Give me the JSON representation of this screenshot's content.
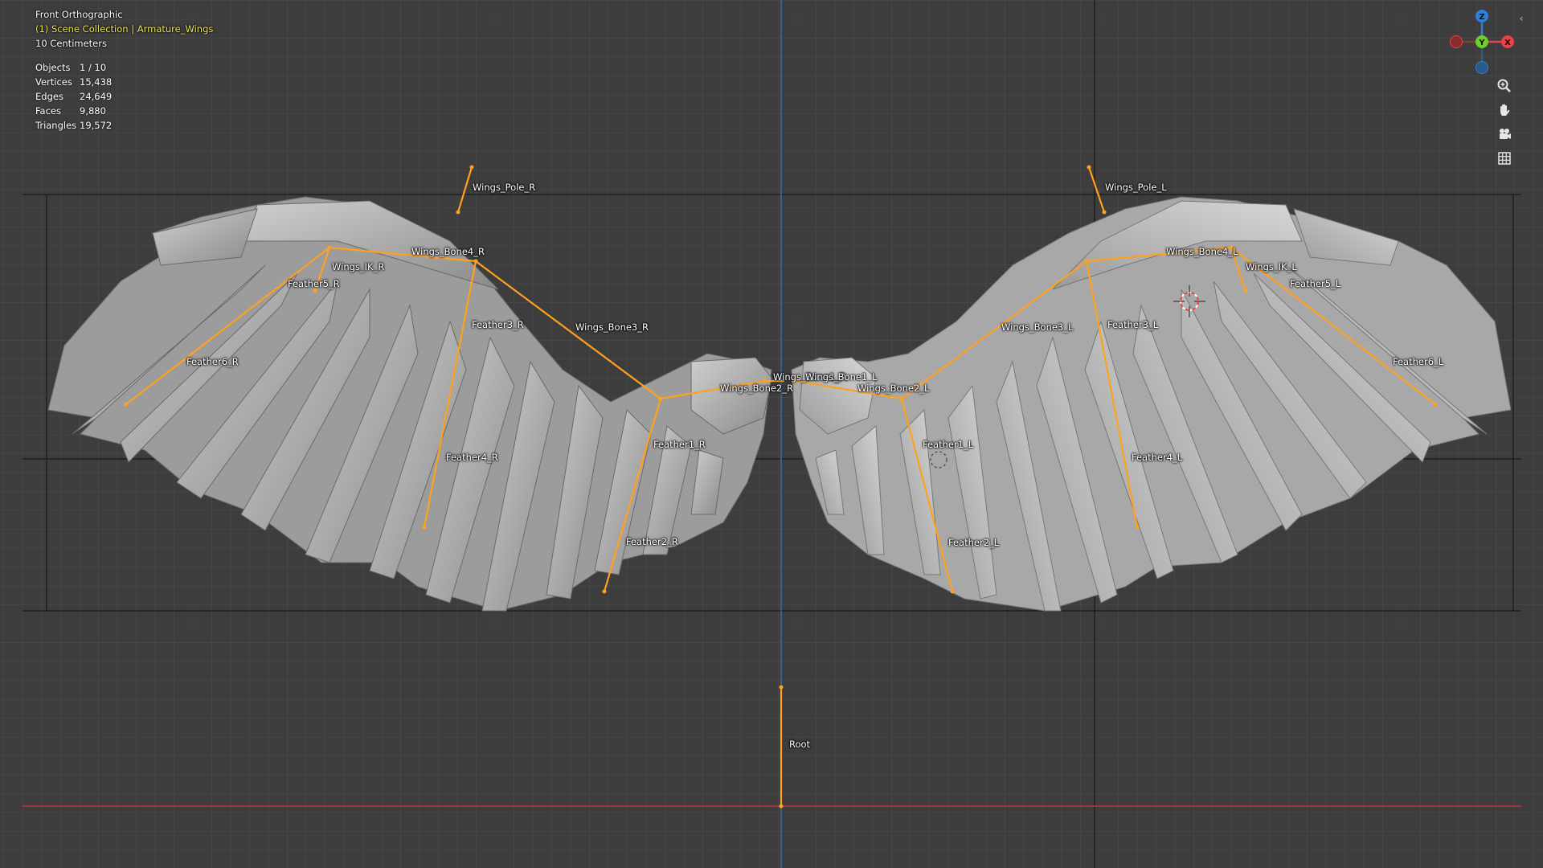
{
  "viewport": {
    "view_name": "Front Orthographic",
    "collection_info": "(1) Scene Collection | Armature_Wings",
    "grid_scale": "10 Centimeters",
    "colors": {
      "background": "#3d3d3d",
      "collection_text": "#f0e44c",
      "bone": "#ffa020",
      "x_axis": "#c03535",
      "z_axis": "#2f6fb0"
    }
  },
  "stats": [
    {
      "label": "Objects",
      "value": "1 / 10"
    },
    {
      "label": "Vertices",
      "value": "15,438"
    },
    {
      "label": "Edges",
      "value": "24,649"
    },
    {
      "label": "Faces",
      "value": "9,880"
    },
    {
      "label": "Triangles",
      "value": "19,572"
    }
  ],
  "bones": {
    "wings_pole_r": "Wings_Pole_R",
    "wings_pole_l": "Wings_Pole_L",
    "wings_bone4_r": "Wings_Bone4_R",
    "wings_bone4_l": "Wings_Bone4_L",
    "wings_ik_r": "Wings_IK_R",
    "wings_ik_l": "Wings_IK_L",
    "feather5_r": "Feather5_R",
    "feather5_l": "Feather5_L",
    "feather3_r": "Feather3_R",
    "feather3_l": "Feather3_L",
    "wings_bone3_r": "Wings_Bone3_R",
    "wings_bone3_l": "Wings_Bone3_L",
    "feather6_r": "Feather6_R",
    "feather6_l": "Feather6_L",
    "wings_bone1_r": "Wings_Bone1_R",
    "wings_bone1_l": "Wings_Bone1_L",
    "wings_bone2_r": "Wings_Bone2_R",
    "wings_bone2_l": "Wings_Bone2_L",
    "feather1_r": "Feather1_R",
    "feather1_l": "Feather1_L",
    "feather4_r": "Feather4_R",
    "feather4_l": "Feather4_L",
    "feather2_r": "Feather2_R",
    "feather2_l": "Feather2_L",
    "root": "Root"
  },
  "gizmo": {
    "z_label": "Z",
    "y_label": "Y",
    "x_label": "X",
    "z_color": "#2f7fd8",
    "y_color": "#6ccf2c",
    "x_color": "#e8424a"
  },
  "navigation_tools": [
    {
      "name": "zoom",
      "icon": "zoom-icon"
    },
    {
      "name": "pan",
      "icon": "hand-pan-icon"
    },
    {
      "name": "camera",
      "icon": "camera-icon"
    },
    {
      "name": "perspective",
      "icon": "grid-icon"
    }
  ],
  "sidebar_toggle": "‹"
}
